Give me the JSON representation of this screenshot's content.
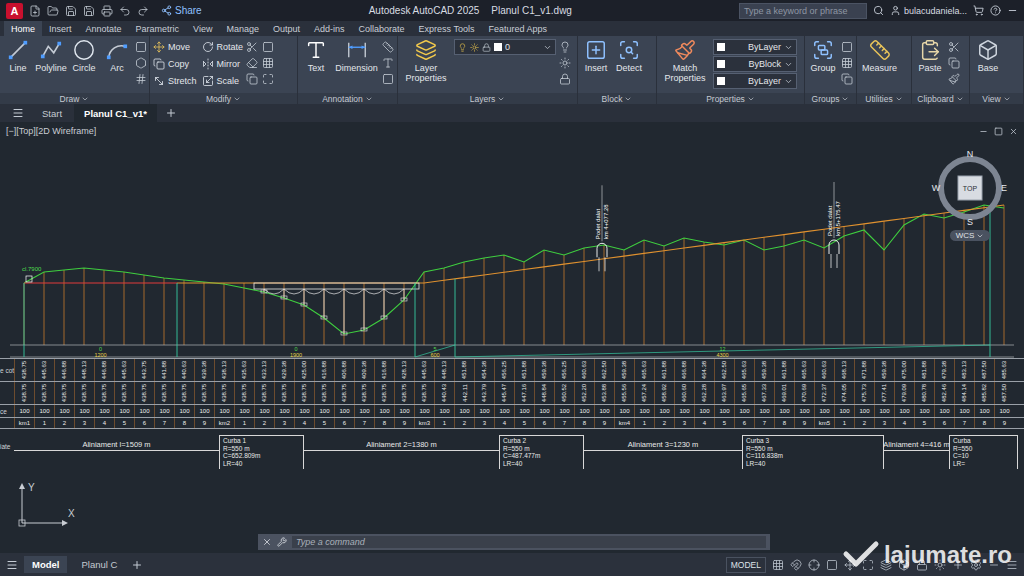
{
  "window": {
    "logo": "A",
    "title": "Autodesk AutoCAD 2025",
    "file": "Planul C1_v1.dwg",
    "share": "Share"
  },
  "search": {
    "placeholder": "Type a keyword or phrase"
  },
  "user": {
    "name": "bulacudaniela..."
  },
  "ribbon_tabs": [
    {
      "label": "Home",
      "selected": true
    },
    {
      "label": "Insert",
      "selected": false
    },
    {
      "label": "Annotate",
      "selected": false
    },
    {
      "label": "Parametric",
      "selected": false
    },
    {
      "label": "View",
      "selected": false
    },
    {
      "label": "Manage",
      "selected": false
    },
    {
      "label": "Output",
      "selected": false
    },
    {
      "label": "Add-ins",
      "selected": false
    },
    {
      "label": "Collaborate",
      "selected": false
    },
    {
      "label": "Express Tools",
      "selected": false
    },
    {
      "label": "Featured Apps",
      "selected": false
    }
  ],
  "ribbon": [
    {
      "label": "Draw",
      "tools": [
        {
          "label": "Line",
          "kind": "large"
        },
        {
          "label": "Polyline",
          "kind": "large"
        },
        {
          "label": "Circle",
          "kind": "large"
        },
        {
          "label": "Arc",
          "kind": "large"
        }
      ]
    },
    {
      "label": "Modify",
      "tools": [
        {
          "label": "Move",
          "kind": "small"
        },
        {
          "label": "Copy",
          "kind": "small"
        },
        {
          "label": "Stretch",
          "kind": "small"
        },
        {
          "label": "Rotate",
          "kind": "small"
        },
        {
          "label": "Mirror",
          "kind": "small"
        },
        {
          "label": "Scale",
          "kind": "small"
        }
      ]
    },
    {
      "label": "Annotation",
      "tools": [
        {
          "label": "Text",
          "kind": "large"
        },
        {
          "label": "Dimension",
          "kind": "large"
        }
      ]
    },
    {
      "label": "Layers",
      "tools": [
        {
          "label": "Layer Properties",
          "kind": "large"
        },
        {
          "label": "0",
          "kind": "dropdown"
        }
      ]
    },
    {
      "label": "Block",
      "tools": [
        {
          "label": "Insert",
          "kind": "large"
        },
        {
          "label": "Detect",
          "kind": "large"
        }
      ]
    },
    {
      "label": "Properties",
      "tools": [
        {
          "label": "Match Properties",
          "kind": "large"
        },
        {
          "label": "ByLayer",
          "kind": "dropdown"
        },
        {
          "label": "ByBlock",
          "kind": "dropdown"
        },
        {
          "label": "ByLayer",
          "kind": "dropdown"
        }
      ]
    },
    {
      "label": "Groups",
      "tools": [
        {
          "label": "Group",
          "kind": "large"
        }
      ]
    },
    {
      "label": "Utilities",
      "tools": [
        {
          "label": "Measure",
          "kind": "large"
        }
      ]
    },
    {
      "label": "Clipboard",
      "tools": [
        {
          "label": "Paste",
          "kind": "large"
        }
      ]
    },
    {
      "label": "View",
      "tools": [
        {
          "label": "Base",
          "kind": "large"
        }
      ]
    }
  ],
  "file_tabs": [
    {
      "label": "Start",
      "selected": false
    },
    {
      "label": "Planul C1_v1*",
      "selected": true
    }
  ],
  "viewport": {
    "controls": "[−][Top][2D Wireframe]"
  },
  "viewcube": {
    "north": "N",
    "south": "S",
    "east": "E",
    "west": "W",
    "face": "TOP",
    "ucs": "WCS"
  },
  "profile": {
    "marker": "cl.7900",
    "terrain": [
      438.75,
      445.63,
      446.88,
      448.13,
      446.88,
      445.63,
      443.75,
      441.88,
      440.63,
      439.38,
      438.13,
      435.63,
      433.13,
      429.38,
      425.0,
      416.88,
      406.88,
      409.38,
      416.88,
      428.13,
      445.63,
      448.13,
      451.88,
      454.38,
      456.25,
      451.88,
      459.38,
      456.25,
      460.63,
      462.5,
      459.38,
      465.63,
      461.88,
      466.88,
      464.38,
      462.5,
      465.63,
      459.38,
      461.88,
      465.63,
      460.63,
      468.13,
      471.88,
      459.38,
      475.0,
      481.88,
      479.38,
      483.13,
      487.5,
      485.63
    ],
    "grade": [
      438.75,
      438.75,
      438.75,
      438.75,
      438.75,
      438.75,
      438.75,
      438.75,
      438.75,
      438.75,
      438.75,
      438.75,
      438.75,
      438.75,
      438.75,
      438.75,
      438.75,
      438.75,
      438.75,
      438.75,
      438.75,
      440.43,
      442.11,
      443.79,
      445.47,
      447.16,
      448.84,
      450.52,
      452.2,
      453.88,
      455.56,
      457.24,
      458.92,
      460.6,
      462.28,
      463.97,
      465.65,
      467.33,
      469.01,
      470.69,
      472.37,
      474.05,
      475.73,
      477.41,
      479.09,
      480.78,
      482.46,
      484.14,
      485.82,
      487.5
    ],
    "grade_segments": [
      {
        "from": 0,
        "to": 7.65,
        "color": "#e23b3b"
      },
      {
        "from": 7.65,
        "to": 49,
        "color": "#e0912f"
      }
    ],
    "slopes": [
      {
        "slope": "0",
        "length": "1200",
        "from": 0,
        "to": 7.65
      },
      {
        "slope": "0",
        "length": "1900",
        "from": 7.65,
        "to": 19.55
      },
      {
        "slope": "5",
        "length": "600",
        "from": 19.55,
        "to": 21.55
      },
      {
        "slope": "12",
        "length": "4300",
        "from": 21.55,
        "to": 48.3
      }
    ],
    "structures": [
      {
        "kind": "bridge",
        "from": 11.5,
        "to": 19.75
      },
      {
        "kind": "culvert",
        "at": 28.9,
        "label": "Podet dalat",
        "km": "km 4+077.28"
      },
      {
        "kind": "culvert",
        "at": 40.5,
        "label": "Podet dalat",
        "km": "km 5+175.47"
      }
    ]
  },
  "table": {
    "rows": [
      {
        "label": "e cot",
        "kind": "vertical",
        "cells": [
          "438.75",
          "445.63",
          "446.88",
          "448.13",
          "446.88",
          "445.63",
          "443.75",
          "441.88",
          "440.63",
          "439.38",
          "438.13",
          "435.63",
          "433.13",
          "429.38",
          "425.00",
          "416.88",
          "406.88",
          "409.38",
          "416.88",
          "428.13",
          "445.63",
          "448.13",
          "451.88",
          "454.38",
          "456.25",
          "451.88",
          "459.38",
          "456.25",
          "460.63",
          "462.50",
          "459.38",
          "465.63",
          "461.88",
          "466.88",
          "464.38",
          "462.50",
          "465.63",
          "459.38",
          "461.88",
          "465.63",
          "460.63",
          "468.13",
          "471.88",
          "459.38",
          "475.00",
          "481.88",
          "479.38",
          "483.13",
          "487.50",
          "485.63"
        ]
      },
      {
        "label": "",
        "kind": "vertical",
        "cells": [
          "438.75",
          "438.75",
          "438.75",
          "438.75",
          "438.75",
          "438.75",
          "438.75",
          "438.75",
          "438.75",
          "438.75",
          "438.75",
          "438.75",
          "438.75",
          "438.75",
          "438.75",
          "438.75",
          "438.75",
          "438.75",
          "438.75",
          "438.75",
          "438.75",
          "440.43",
          "442.11",
          "443.79",
          "445.47",
          "447.16",
          "448.84",
          "450.52",
          "452.20",
          "453.88",
          "455.56",
          "457.24",
          "458.92",
          "460.60",
          "462.28",
          "463.97",
          "465.65",
          "467.33",
          "469.01",
          "470.69",
          "472.37",
          "474.05",
          "475.73",
          "477.41",
          "479.09",
          "480.78",
          "482.46",
          "484.14",
          "485.82",
          "487.50"
        ]
      },
      {
        "label": "ce",
        "kind": "flat",
        "cells": [
          "100",
          "100",
          "100",
          "100",
          "100",
          "100",
          "100",
          "100",
          "100",
          "100",
          "100",
          "100",
          "100",
          "100",
          "100",
          "100",
          "100",
          "100",
          "100",
          "100",
          "100",
          "100",
          "100",
          "100",
          "100",
          "100",
          "100",
          "100",
          "100",
          "100",
          "100",
          "100",
          "100",
          "100",
          "100",
          "100",
          "100",
          "100",
          "100",
          "100",
          "100",
          "100",
          "100",
          "100",
          "100",
          "100",
          "100",
          "100",
          "100",
          "100"
        ]
      },
      {
        "label": "",
        "kind": "flat",
        "cells": [
          "km1",
          "1",
          "2",
          "3",
          "4",
          "5",
          "6",
          "7",
          "8",
          "9",
          "km2",
          "1",
          "2",
          "3",
          "4",
          "5",
          "6",
          "7",
          "8",
          "9",
          "km3",
          "1",
          "2",
          "3",
          "4",
          "5",
          "6",
          "7",
          "8",
          "9",
          "km4",
          "1",
          "2",
          "3",
          "4",
          "5",
          "6",
          "7",
          "8",
          "9",
          "km5",
          "1",
          "2",
          "3",
          "4",
          "5",
          "6",
          "7",
          "8",
          "9"
        ]
      }
    ]
  },
  "alignment": {
    "label": "iate",
    "segments": [
      {
        "kind": "aliniament",
        "lines": [
          "Aliniament l=1509 m"
        ]
      },
      {
        "kind": "curba",
        "lines": [
          "Curba 1",
          "R=550 m",
          "C=652.809m",
          "LR=40"
        ]
      },
      {
        "kind": "aliniament",
        "lines": [
          "Aliniament 2=1380 m"
        ]
      },
      {
        "kind": "curba",
        "lines": [
          "Curba 2",
          "R=550 m",
          "C=487.477m",
          "LR=40"
        ]
      },
      {
        "kind": "aliniament",
        "lines": [
          "Aliniament 3=1230 m"
        ]
      },
      {
        "kind": "curba",
        "lines": [
          "Curba 3",
          "R=550 m",
          "C=116.838m",
          "LR=40"
        ]
      },
      {
        "kind": "aliniament",
        "lines": [
          "Aliniament 4=416 m"
        ]
      },
      {
        "kind": "curba",
        "lines": [
          "Curba",
          "R=550",
          "C=10",
          "LR="
        ]
      }
    ]
  },
  "ucs": {
    "y": "Y",
    "x": "X"
  },
  "command": {
    "placeholder": "Type a command"
  },
  "status": {
    "layout_tabs": [
      {
        "label": "Model",
        "selected": true
      },
      {
        "label": "Planul C",
        "selected": false
      }
    ],
    "mode": "MODEL"
  },
  "watermark": {
    "text": "lajumate.ro"
  }
}
